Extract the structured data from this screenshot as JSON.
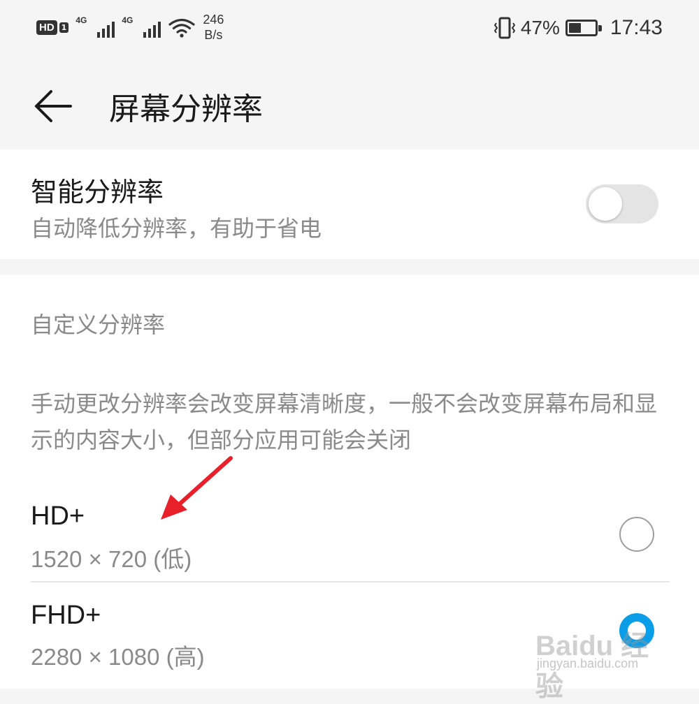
{
  "status_bar": {
    "hd_label": "HD",
    "hd_sim": "1",
    "network_1": "4G",
    "network_2": "4G",
    "net_speed_value": "246",
    "net_speed_unit": "B/s",
    "battery_percent": "47%",
    "battery_level": 0.47,
    "time": "17:43"
  },
  "header": {
    "back_icon": "arrow-left-icon",
    "title": "屏幕分辨率"
  },
  "smart_resolution": {
    "title": "智能分辨率",
    "subtitle": "自动降低分辨率，有助于省电",
    "enabled": false
  },
  "custom_resolution": {
    "section_title": "自定义分辨率",
    "description": "手动更改分辨率会改变屏幕清晰度，一般不会改变屏幕布局和显示的内容大小，但部分应用可能会关闭",
    "options": [
      {
        "title": "HD+",
        "subtitle": "1520 × 720 (低)",
        "selected": false
      },
      {
        "title": "FHD+",
        "subtitle": "2280 × 1080 (高)",
        "selected": true
      }
    ]
  },
  "watermark": {
    "brand": "Baidu 经验",
    "url": "jingyan.baidu.com"
  },
  "colors": {
    "accent": "#0a9ee8",
    "annotation_arrow": "#e8202a"
  }
}
